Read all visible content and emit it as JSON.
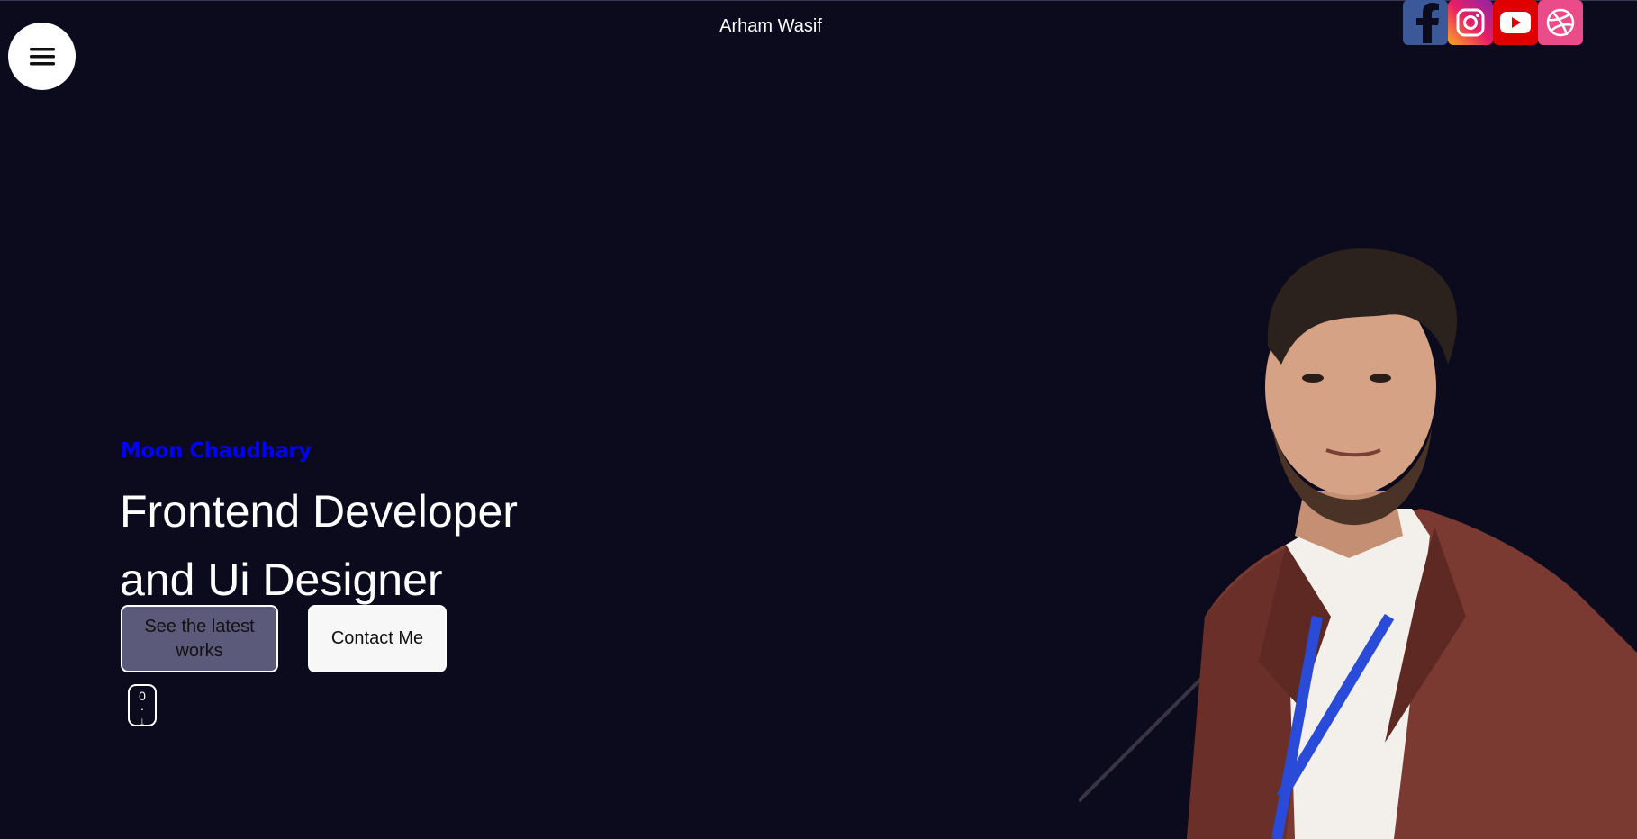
{
  "header": {
    "title": "Arham Wasif",
    "menu_icon": "hamburger-icon"
  },
  "socials": [
    {
      "name": "facebook",
      "icon": "facebook-icon",
      "color": "#3b5998"
    },
    {
      "name": "instagram",
      "icon": "instagram-icon",
      "color": "#d6249f"
    },
    {
      "name": "youtube",
      "icon": "youtube-icon",
      "color": "#e00000"
    },
    {
      "name": "dribbble",
      "icon": "dribbble-icon",
      "color": "#ea4c89"
    }
  ],
  "hero": {
    "name": "Moon Chaudhary",
    "headline_line1": "Frontend Developer",
    "headline_line2": "and Ui Designer",
    "works_button": "See the latest works",
    "contact_button": "Contact Me",
    "scroll_top": "0",
    "scroll_dot": "·",
    "scroll_arrow": "↓"
  },
  "colors": {
    "background": "#0c0b1d",
    "accent_name": "#0000ff",
    "works_button_bg": "#5c5a7a",
    "contact_button_bg": "#f7f7f7"
  }
}
